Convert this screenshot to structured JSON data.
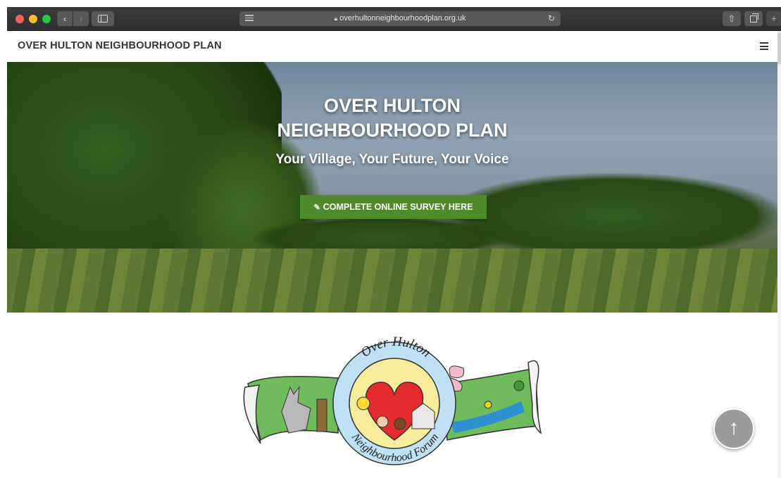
{
  "browser": {
    "url": "overhultonneighbourhoodplan.org.uk",
    "icons": {
      "back": "chevron-left-icon",
      "forward": "chevron-right-icon",
      "sidebar": "sidebar-icon",
      "reader": "reader-icon",
      "lock": "lock-icon",
      "reload": "reload-icon",
      "share": "share-icon",
      "tabs": "tabs-icon",
      "new_tab": "plus-icon"
    }
  },
  "navbar": {
    "brand": "OVER HULTON NEIGHBOURHOOD PLAN",
    "menu_icon": "hamburger-icon"
  },
  "hero": {
    "title_line1": "OVER HULTON",
    "title_line2": "NEIGHBOURHOOD PLAN",
    "subtitle": "Your Village, Your Future, Your Voice",
    "cta_label": "COMPLETE ONLINE SURVEY HERE",
    "cta_icon": "edit-icon",
    "cta_color": "#4f8a2b"
  },
  "logo": {
    "text_top": "Over Hulton",
    "text_bottom": "Neighbourhood Forum"
  },
  "scroll_top_icon": "arrow-up-icon"
}
